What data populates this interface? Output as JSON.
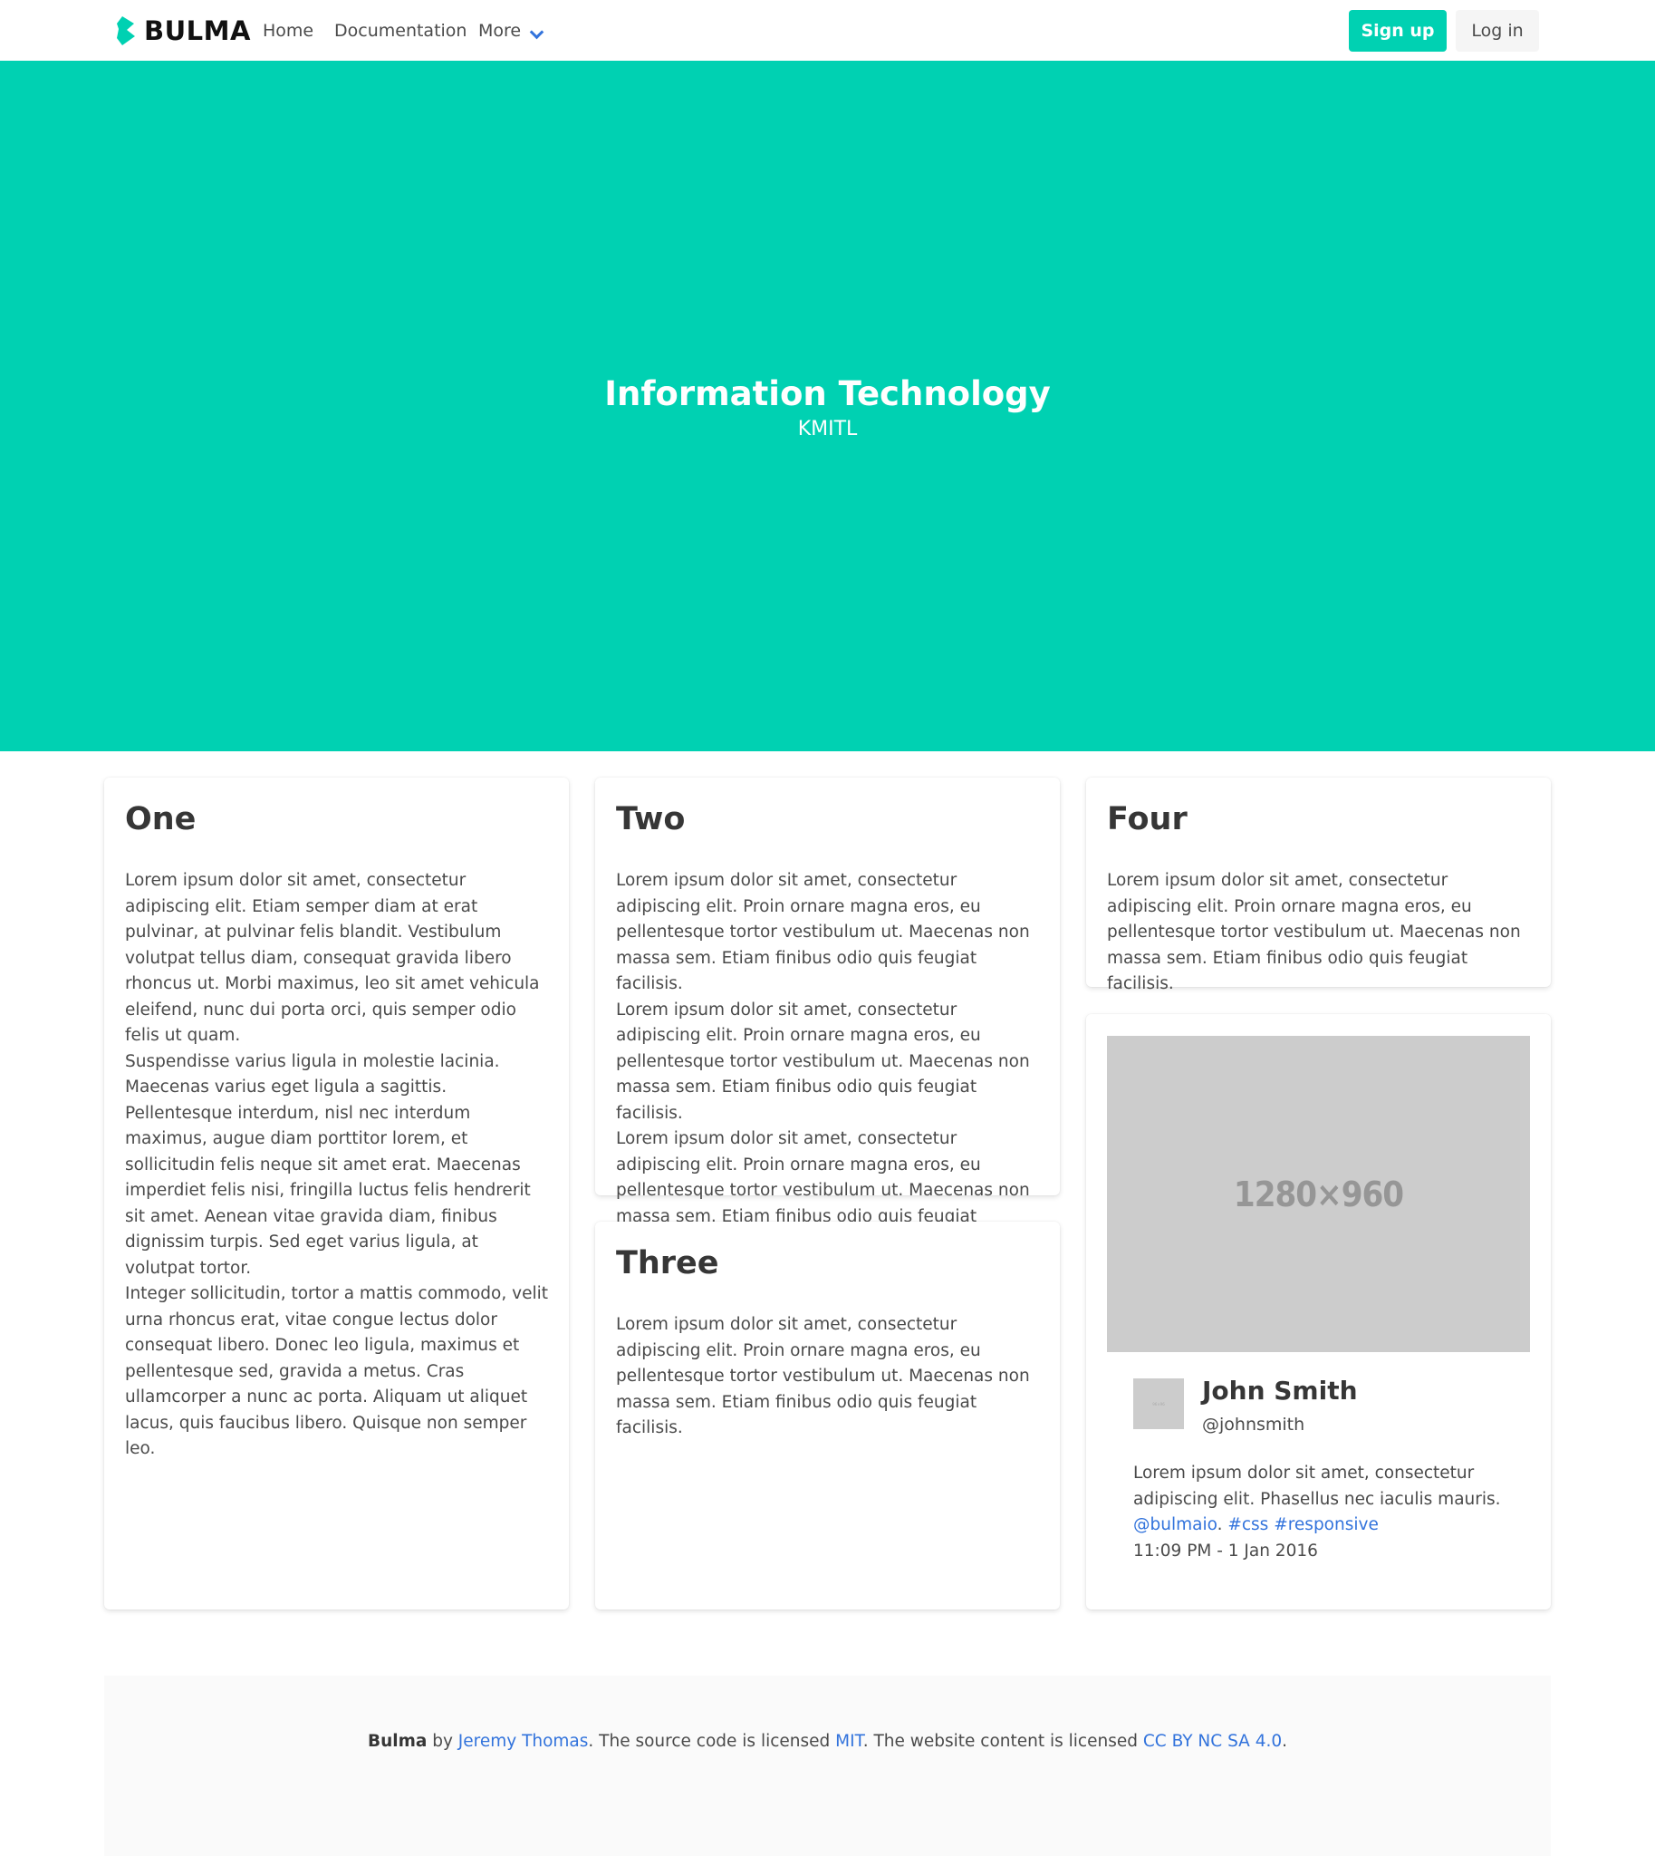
{
  "navbar": {
    "brand": "BULMA",
    "links": [
      "Home",
      "Documentation",
      "More"
    ],
    "signup_label": "Sign up",
    "login_label": "Log in"
  },
  "hero": {
    "title": "Information Technology",
    "subtitle": "KMITL"
  },
  "cards": {
    "one": {
      "title": "One",
      "paragraphs": [
        "Lorem ipsum dolor sit amet, consectetur adipiscing elit. Etiam semper diam at erat pulvinar, at pulvinar felis blandit. Vestibulum volutpat tellus diam, consequat gravida libero rhoncus ut. Morbi maximus, leo sit amet vehicula eleifend, nunc dui porta orci, quis semper odio felis ut quam.",
        "Suspendisse varius ligula in molestie lacinia. Maecenas varius eget ligula a sagittis. Pellentesque interdum, nisl nec interdum maximus, augue diam porttitor lorem, et sollicitudin felis neque sit amet erat. Maecenas imperdiet felis nisi, fringilla luctus felis hendrerit sit amet. Aenean vitae gravida diam, finibus dignissim turpis. Sed eget varius ligula, at volutpat tortor.",
        "Integer sollicitudin, tortor a mattis commodo, velit urna rhoncus erat, vitae congue lectus dolor consequat libero. Donec leo ligula, maximus et pellentesque sed, gravida a metus. Cras ullamcorper a nunc ac porta. Aliquam ut aliquet lacus, quis faucibus libero. Quisque non semper leo."
      ]
    },
    "two": {
      "title": "Two",
      "paragraphs": [
        "Lorem ipsum dolor sit amet, consectetur adipiscing elit. Proin ornare magna eros, eu pellentesque tortor vestibulum ut. Maecenas non massa sem. Etiam finibus odio quis feugiat facilisis.",
        "Lorem ipsum dolor sit amet, consectetur adipiscing elit. Proin ornare magna eros, eu pellentesque tortor vestibulum ut. Maecenas non massa sem. Etiam finibus odio quis feugiat facilisis.",
        "Lorem ipsum dolor sit amet, consectetur adipiscing elit. Proin ornare magna eros, eu pellentesque tortor vestibulum ut. Maecenas non massa sem. Etiam finibus odio quis feugiat facilisis."
      ]
    },
    "three": {
      "title": "Three",
      "paragraphs": [
        "Lorem ipsum dolor sit amet, consectetur adipiscing elit. Proin ornare magna eros, eu pellentesque tortor vestibulum ut. Maecenas non massa sem. Etiam finibus odio quis feugiat facilisis."
      ]
    },
    "four": {
      "title": "Four",
      "paragraphs": [
        "Lorem ipsum dolor sit amet, consectetur adipiscing elit. Proin ornare magna eros, eu pellentesque tortor vestibulum ut. Maecenas non massa sem. Etiam finibus odio quis feugiat facilisis."
      ]
    },
    "profile": {
      "image_label": "1280×960",
      "name": "John Smith",
      "handle": "@johnsmith",
      "text": "Lorem ipsum dolor sit amet, consectetur adipiscing elit. Phasellus nec iaculis mauris.",
      "mention": "@bulmaio",
      "tag_css": "#css",
      "tag_responsive": "#responsive",
      "timestamp": "11:09 PM - 1 Jan 2016"
    }
  },
  "footer": {
    "brand": "Bulma",
    "by": " by ",
    "author": "Jeremy Thomas",
    "source_text": ". The source code is licensed ",
    "license_code": "MIT",
    "content_text": ". The website content is licensed ",
    "license_content": "CC BY NC SA 4.0",
    "end": "."
  },
  "colors": {
    "primary": "#00d1b2",
    "link": "#3273dc",
    "text": "#4a4a4a",
    "title": "#363636",
    "footer_bg": "#fafafa",
    "placeholder": "#cccccc"
  }
}
